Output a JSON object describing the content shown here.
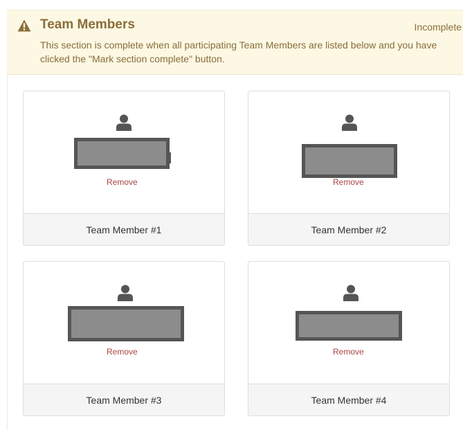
{
  "section": {
    "title": "Team Members",
    "status": "Incomplete",
    "description": "This section is complete when all participating Team Members are listed below and you have clicked the \"Mark section complete\" button."
  },
  "members": [
    {
      "label": "Team Member #1",
      "remove_label": "Remove"
    },
    {
      "label": "Team Member #2",
      "remove_label": "Remove"
    },
    {
      "label": "Team Member #3",
      "remove_label": "Remove"
    },
    {
      "label": "Team Member #4",
      "remove_label": "Remove"
    }
  ],
  "colors": {
    "warning_background": "#fcf8e3",
    "warning_text": "#8a6d3b",
    "remove_link": "#a94442",
    "icon": "#555555",
    "redaction_fill": "#8c8c8c",
    "redaction_border": "#555555"
  },
  "icons": {
    "warning": "warning-triangle-icon",
    "member": "user-icon"
  }
}
